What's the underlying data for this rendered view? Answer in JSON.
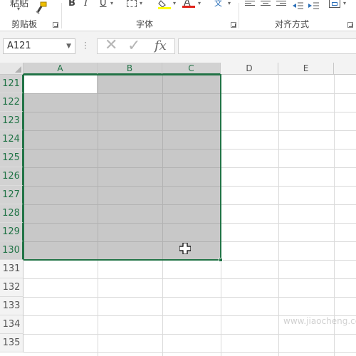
{
  "ribbon": {
    "clipboard_group_label": "剪贴板",
    "paste_label_partial": "粘贴",
    "font_group_label": "字体",
    "alignment_group_label": "对齐方式",
    "bold_label": "B",
    "italic_label": "I",
    "underline_label": "U",
    "font_color_label": "A",
    "font_color_hex": "#e0231b",
    "highlight_color_hex": "#ffff00",
    "wen_label": "文"
  },
  "formula_bar": {
    "name_box_value": "A121",
    "formula_value": ""
  },
  "grid": {
    "columns": [
      "A",
      "B",
      "C",
      "D",
      "E"
    ],
    "selected_columns": [
      "A",
      "B",
      "C"
    ],
    "rows": [
      "121",
      "122",
      "123",
      "124",
      "125",
      "126",
      "127",
      "128",
      "129",
      "130",
      "131",
      "132",
      "133",
      "134",
      "135"
    ],
    "selected_rows": [
      "121",
      "122",
      "123",
      "124",
      "125",
      "126",
      "127",
      "128",
      "129",
      "130"
    ],
    "active_cell": "A121",
    "selection_range": "A121:C130",
    "accent_color": "#217346",
    "selection_fill": "#c8c8c8"
  },
  "watermark": "www.jiaocheng.com"
}
